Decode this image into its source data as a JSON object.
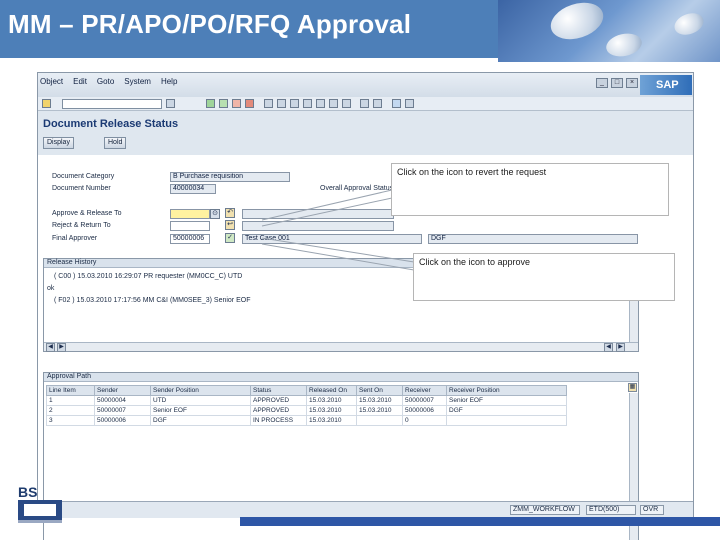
{
  "slide": {
    "title": "MM – PR/APO/PO/RFQ Approval",
    "logo_text": "BS"
  },
  "sap": {
    "menu": [
      "Object",
      "Edit",
      "Goto",
      "System",
      "Help"
    ],
    "logo": "SAP",
    "screen_title": "Document Release Status",
    "buttons": {
      "display": "Display",
      "hold": "Hold"
    },
    "form": {
      "document_category_label": "Document Category",
      "document_category_value": "B  Purchase requisition",
      "document_number_label": "Document Number",
      "document_number_value": "40000034",
      "overall_status_label": "Overall Approval Status",
      "approve_label": "Approve & Release To",
      "reject_label": "Reject & Return To",
      "final_approver_label": "Final Approver",
      "final_approver_id": "50000006",
      "final_approver_name": "Test Case 001",
      "final_approver_pos": "DGF"
    },
    "history": {
      "title": "Release History",
      "lines": [
        "( C00 )  15.03.2010  16:29:07  PR requester (MM0CC_C)  UTD",
        "ok",
        "( F02 )  15.03.2010  17:17:56  MM C&I  (MM0SEE_3)  Senior EOF"
      ]
    },
    "approval_path": {
      "title": "Approval Path",
      "columns": [
        "Line Item",
        "Sender",
        "Sender Position",
        "Status",
        "Released On",
        "Sent On",
        "Receiver",
        "Receiver Position"
      ],
      "rows": [
        [
          "1",
          "50000004",
          "UTD",
          "APPROVED",
          "15.03.2010",
          "15.03.2010",
          "50000007",
          "Senior EOF"
        ],
        [
          "2",
          "50000007",
          "Senior EOF",
          "APPROVED",
          "15.03.2010",
          "15.03.2010",
          "50000006",
          "DGF"
        ],
        [
          "3",
          "50000006",
          "DGF",
          "IN PROCESS",
          "15.03.2010",
          "",
          "0",
          ""
        ]
      ]
    },
    "status_bar": {
      "transaction": "ZMM_WORKFLOW",
      "server": "ETD(500)",
      "mode": "OVR"
    }
  },
  "callouts": {
    "revert": "Click on the icon to revert the request",
    "approve": "Click on the icon to approve"
  }
}
